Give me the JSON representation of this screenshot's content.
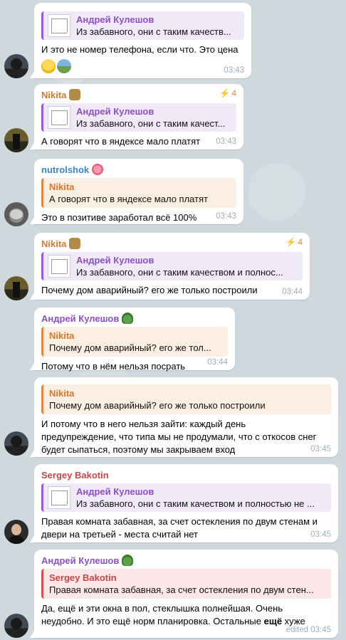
{
  "messages": [
    {
      "reply": {
        "name": "Андрей Кулешов",
        "text": "Из забавного, они с таким качеств..."
      },
      "body": "И это не номер телефона, если что. Это цена",
      "time": "03:43"
    },
    {
      "sender": "Nikita",
      "fwd_count": "4",
      "reply": {
        "name": "Андрей Кулешов",
        "text": "Из забавного, они с таким качест..."
      },
      "body": "А говорят что в яндексе мало платят",
      "time": "03:43"
    },
    {
      "sender": "nutrolshok",
      "reply": {
        "name": "Nikita",
        "text": "А говорят что в яндексе мало платят"
      },
      "body": "Это в позитиве заработал всё 100%",
      "time": "03:43"
    },
    {
      "sender": "Nikita",
      "fwd_count": "4",
      "reply": {
        "name": "Андрей Кулешов",
        "text": "Из забавного, они с таким качеством и полнос..."
      },
      "body": "Почему дом аварийный? его же только построили",
      "time": "03:44"
    },
    {
      "sender": "Андрей Кулешов",
      "reply": {
        "name": "Nikita",
        "text": "Почему дом аварийный? его же тол..."
      },
      "body": "Потому что в нём нельзя посрать",
      "time": "03:44"
    },
    {
      "reply": {
        "name": "Nikita",
        "text": "Почему дом аварийный? его же только построили"
      },
      "body_lines": [
        "И потому что в него нельзя зайти: каждый день",
        "предупреждение, что типа мы не продумали, что с откосов снег",
        "будет сыпаться, поэтому мы закрываем вход"
      ],
      "time": "03:45"
    },
    {
      "sender": "Sergey Bakotin",
      "reply": {
        "name": "Андрей Кулешов",
        "text": "Из забавного, они с таким качеством и полностью не ..."
      },
      "body_lines": [
        "Правая комната забавная, за счет остекления по двум стенам и",
        "двери на третьей - места считай нет"
      ],
      "time": "03:45"
    },
    {
      "sender": "Андрей Кулешов",
      "reply": {
        "name": "Sergey Bakotin",
        "text": "Правая комната забавная, за счет остекления по двум стен..."
      },
      "body_lines": [
        "Да, ещё и эти окна в пол, стеклышка полнейшая. Очень",
        "неудобно. И это ещё норм планировка. Остальные"
      ],
      "body_bold": "ещё",
      "body_tail": " хуже",
      "time": "edited 03:45"
    }
  ],
  "colors": {
    "nikita": "#d9772a",
    "nutrolshok": "#3a86c8",
    "andrey": "#8e4fc4",
    "sergey": "#c94646",
    "time": "#a0acb6"
  }
}
